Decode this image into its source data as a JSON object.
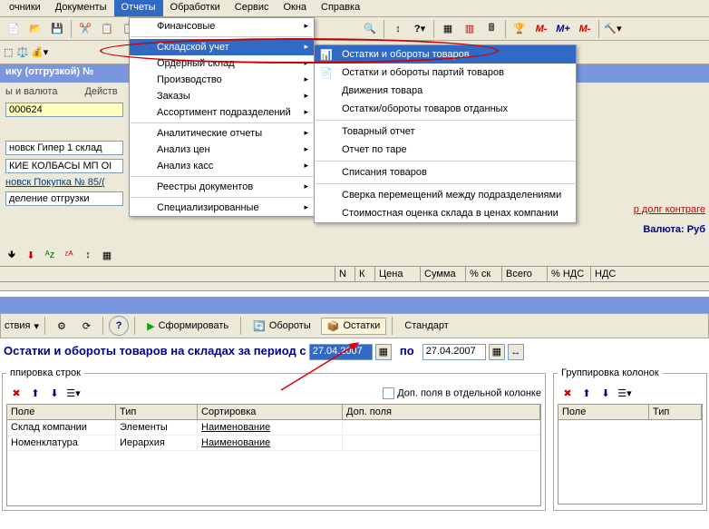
{
  "menubar": {
    "m0": "очники",
    "m1": "Документы",
    "m2": "Отчеты",
    "m3": "Обработки",
    "m4": "Сервис",
    "m5": "Окна",
    "m6": "Справка"
  },
  "dropdown1": {
    "i0": "Финансовые",
    "i1": "Складской учет",
    "i2": "Ордерный склад",
    "i3": "Производство",
    "i4": "Заказы",
    "i5": "Ассортимент подразделений",
    "i6": "Аналитические отчеты",
    "i7": "Анализ цен",
    "i8": "Анализ касс",
    "i9": "Реестры документов",
    "i10": "Специализированные"
  },
  "submenu": {
    "s0": "Остатки и обороты товаров",
    "s1": "Остатки и обороты партий товаров",
    "s2": "Движения товара",
    "s3": "Остатки/обороты товаров отданных",
    "s4": "Товарный отчет",
    "s5": "Отчет по таре",
    "s6": "Списания товаров",
    "s7": "Сверка перемещений между подразделениями",
    "s8": "Стоимостная оценка склада в ценах компании"
  },
  "docheader": "ику (отгрузкой) №",
  "sidebar": {
    "l0": "ы и валюта",
    "l1": "Действ",
    "l2": "000624",
    "l3": "новск Гипер 1 склад",
    "l4": "КИЕ КОЛБАСЫ МП ОI",
    "l5": "новск Покупка № 85/(",
    "l6": "деление отгрузки",
    "l7": "р долг контраге",
    "l8": "Валюта: Руб"
  },
  "gridbottom": {
    "c0": "N",
    "c1": "К",
    "c2": "Цена",
    "c3": "Сумма",
    "c4": "% ск",
    "c5": "Всего",
    "c6": "% НДС",
    "c7": "НДС"
  },
  "bottombar": {
    "b0": "ствия",
    "b1": "Сформировать",
    "b2": "Обороты",
    "b3": "Остатки",
    "b4": "Стандарт"
  },
  "report": {
    "title": "Остатки и обороты товаров на складах за период с",
    "po": "по",
    "date1": "27.04.2007",
    "date2": "27.04.2007"
  },
  "fs1": {
    "legend": "ппировка строк",
    "chk_label": "Доп. поля в отдельной колонке"
  },
  "fs2": {
    "legend": "Группировка колонок"
  },
  "table1": {
    "h0": "Поле",
    "h1": "Тип",
    "h2": "Сортировка",
    "h3": "Доп. поля",
    "r0c0": "Склад компании",
    "r0c1": "Элементы",
    "r0c2": "Наименование",
    "r1c0": "Номенклатура",
    "r1c1": "Иерархия",
    "r1c2": "Наименование"
  },
  "table2": {
    "h0": "Поле",
    "h1": "Тип"
  },
  "toolbar_marks": {
    "m1": "M-",
    "m2": "M+",
    "m3": "M-"
  }
}
